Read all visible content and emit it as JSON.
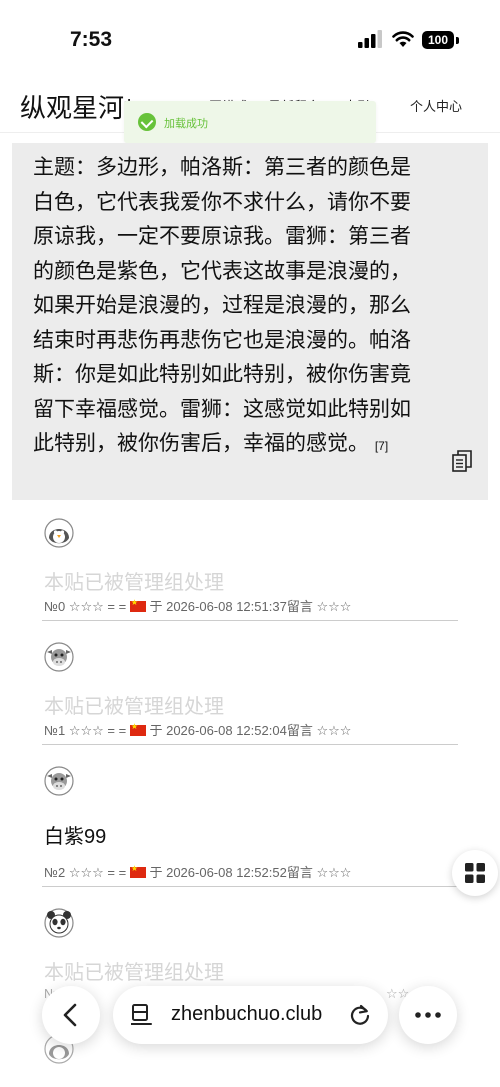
{
  "status_bar": {
    "time": "7:53",
    "battery": "100"
  },
  "header": {
    "site_title": "纵观星河*",
    "nav": [
      "不同模式",
      "最新留言",
      "索引",
      "个人中心"
    ]
  },
  "toast": {
    "message": "加载成功"
  },
  "quote": {
    "text": "主题：多边形，帕洛斯：第三者的颜色是白色，它代表我爱你不求什么，请你不要原谅我，一定不要原谅我。雷狮：第三者的颜色是紫色，它代表这故事是浪漫的，如果开始是浪漫的，过程是浪漫的，那么结束时再悲伤再悲伤它也是浪漫的。帕洛斯：你是如此特别如此特别，被你伤害竟留下幸福感觉。雷狮：这感觉如此特别如此特别，被你伤害后，幸福的感觉。",
    "ref": "[7]"
  },
  "comments": [
    {
      "avatar": "penguin-icon",
      "text": "本贴已被管理组处理",
      "no": "№0",
      "stars_left": "☆☆☆",
      "eq": "= =",
      "yu": "于",
      "time": "2026-06-08 12:51:37",
      "suffix": "留言",
      "stars_right": "☆☆☆"
    },
    {
      "avatar": "cow-icon",
      "text": "本贴已被管理组处理",
      "no": "№1",
      "stars_left": "☆☆☆",
      "eq": "= =",
      "yu": "于",
      "time": "2026-06-08 12:52:04",
      "suffix": "留言",
      "stars_right": "☆☆☆"
    },
    {
      "avatar": "cow-icon",
      "text": "白紫99",
      "no": "№2",
      "stars_left": "☆☆☆",
      "eq": "= =",
      "yu": "于",
      "time": "2026-06-08 12:52:52",
      "suffix": "留言",
      "stars_right": "☆☆☆"
    },
    {
      "avatar": "panda-icon",
      "text": "本贴已被管理组处理",
      "no": "№",
      "stars_left": "☆☆",
      "eq": "",
      "yu": "",
      "time": "",
      "suffix": "",
      "stars_right": "☆☆"
    }
  ],
  "browser": {
    "url": "zhenbuchuo.club"
  },
  "colors": {
    "toast_green": "#67c23a",
    "quote_bg": "#ececec",
    "removed_text": "#d6d6d6"
  }
}
